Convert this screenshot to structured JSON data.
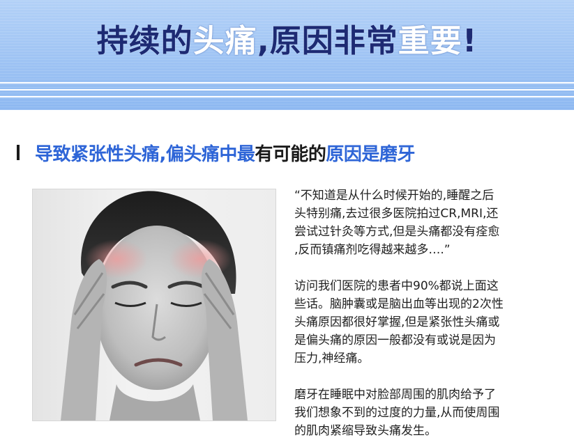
{
  "banner": {
    "title_part1": "持续的",
    "title_part2": "头痛",
    "title_part3": ",原因非常",
    "title_part4": "重要",
    "title_part5": "!"
  },
  "section": {
    "heading_blue1": "导致紧张性头痛,偏头痛中最",
    "heading_black": "有可能的",
    "heading_blue2": "原因是磨牙"
  },
  "paragraphs": [
    {
      "lines": [
        "“不知道是从什么时候开始的,睡醒之后",
        "头特别痛,去过很多医院拍过CR,MRI,还",
        "尝试过针灸等方式,但是头痛都没有痊愈",
        ",反而镇痛剂吃得越来越多….”"
      ]
    },
    {
      "lines": [
        "访问我们医院的患者中90%都说上面这",
        "些话。脑肿囊或是脑出血等出现的2次性",
        "头痛原因都很好掌握,但是紧张性头痛或",
        "是偏头痛的原因一般都没有或说是因为",
        "压力,神经痛。"
      ]
    },
    {
      "lines": [
        "磨牙在睡眠中对脸部周围的肌肉给予了",
        "我们想象不到的过度的力量,从而使周围",
        "的肌肉紧缩导致头痛发生。"
      ]
    }
  ],
  "colors": {
    "banner_top": "#b3d1f7",
    "banner_bottom": "#8db8f1",
    "title_dark": "#1d2a73",
    "heading_blue": "#2e65d7",
    "text": "#1f1f1f"
  }
}
